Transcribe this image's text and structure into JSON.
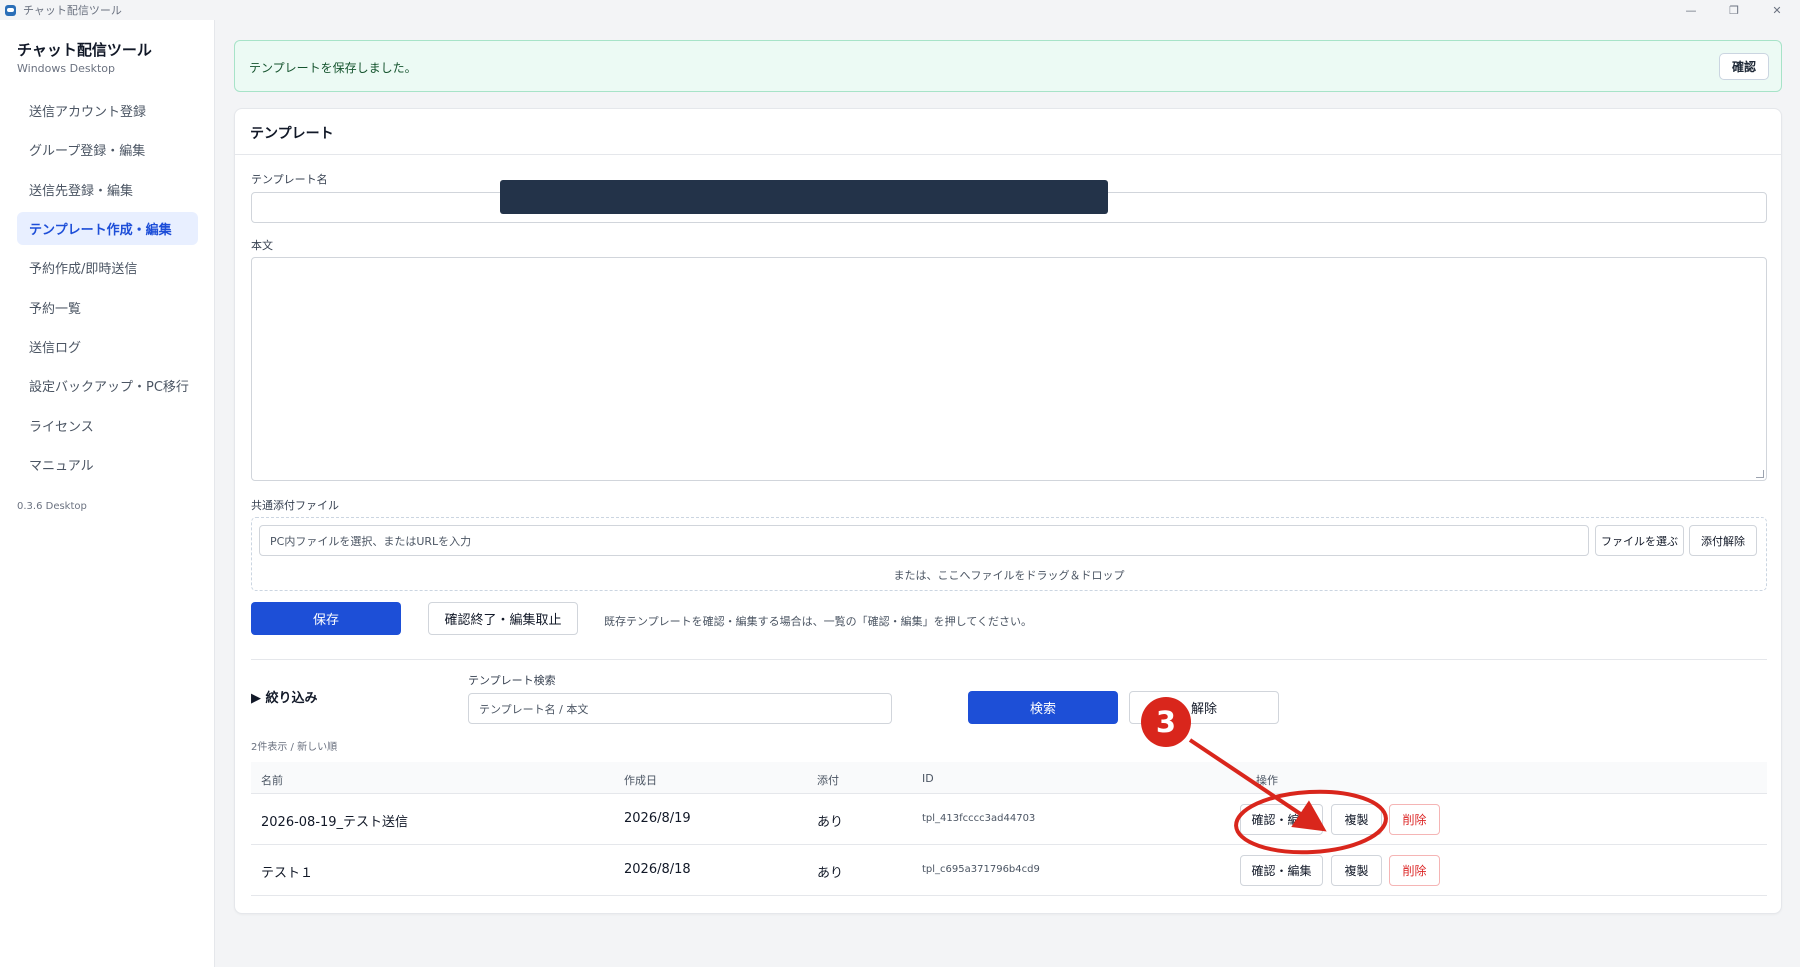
{
  "window": {
    "title": "チャット配信ツール",
    "controls": [
      "—",
      "❐",
      "✕"
    ]
  },
  "sidebar": {
    "app_name": "チャット配信ツール",
    "app_sub": "Windows Desktop",
    "items": [
      {
        "label": "送信アカウント登録",
        "active": false
      },
      {
        "label": "グループ登録・編集",
        "active": false
      },
      {
        "label": "送信先登録・編集",
        "active": false
      },
      {
        "label": "テンプレート作成・編集",
        "active": true
      },
      {
        "label": "予約作成/即時送信",
        "active": false
      },
      {
        "label": "予約一覧",
        "active": false
      },
      {
        "label": "送信ログ",
        "active": false
      },
      {
        "label": "設定バックアップ・PC移行",
        "active": false
      },
      {
        "label": "ライセンス",
        "active": false
      },
      {
        "label": "マニュアル",
        "active": false
      }
    ],
    "version": "0.3.6 Desktop"
  },
  "alert": {
    "message": "テンプレートを保存しました。",
    "button": "確認"
  },
  "template_form": {
    "title": "テンプレート",
    "name_label": "テンプレート名",
    "body_label": "本文",
    "attachment_label": "共通添付ファイル",
    "attachment_placeholder": "PC内ファイルを選択、またはURLを入力",
    "choose_file_button": "ファイルを選ぶ",
    "remove_attachment_button": "添付解除",
    "drop_hint": "または、ここへファイルをドラッグ＆ドロップ",
    "save_button": "保存",
    "cancel_button": "確認終了・編集取止",
    "hint": "既存テンプレートを確認・編集する場合は、一覧の「確認・編集」を押してください。"
  },
  "filter": {
    "toggle": "▶ 絞り込み",
    "search_label": "テンプレート検索",
    "search_placeholder": "テンプレート名 / 本文",
    "search_button": "検索",
    "clear_button": "解除"
  },
  "list": {
    "count_text": "2件表示 / 新しい順",
    "columns": [
      "名前",
      "作成日",
      "添付",
      "ID",
      "操作"
    ],
    "rows": [
      {
        "name": "2026-08-19_テスト送信",
        "created": "2026/8/19",
        "attach": "あり",
        "id": "tpl_413fcccc3ad44703"
      },
      {
        "name": "テスト１",
        "created": "2026/8/18",
        "attach": "あり",
        "id": "tpl_c695a371796b4cd9"
      }
    ],
    "row_actions": {
      "edit": "確認・編集",
      "copy": "複製",
      "delete": "削除"
    }
  },
  "annotation": {
    "step_number": "3",
    "color": "#d9261c"
  },
  "colors": {
    "primary": "#1d4fd7",
    "active_nav_bg": "#e8efff",
    "success_bg": "#ecfaf4",
    "danger": "#dc2626",
    "redaction": "#233349"
  }
}
